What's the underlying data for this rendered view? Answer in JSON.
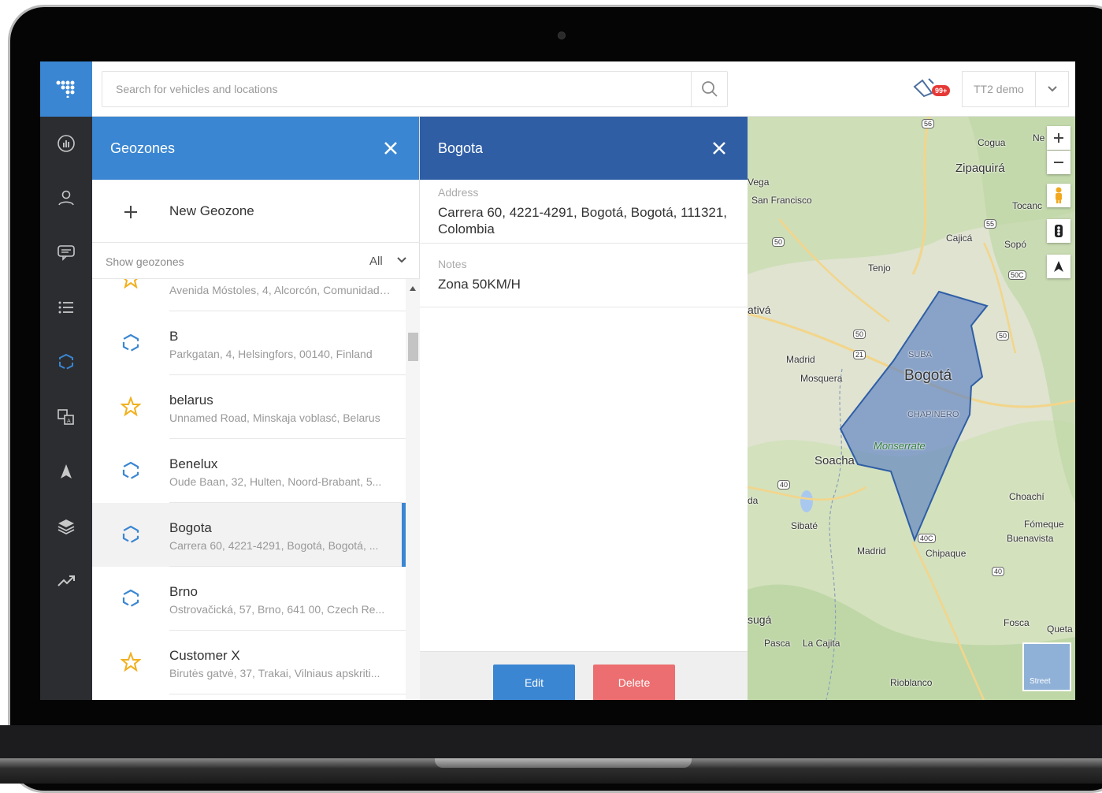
{
  "search": {
    "placeholder": "Search for vehicles and locations"
  },
  "notifications": {
    "badge": "99+"
  },
  "user": {
    "name": "TT2 demo"
  },
  "geozones_panel": {
    "title": "Geozones",
    "new_label": "New Geozone",
    "filter_label": "Show geozones",
    "filter_value": "All",
    "items": [
      {
        "name": "",
        "address": "Avenida Móstoles, 4, Alcorcón, Comunidad de Madrid",
        "icon": "star-icon"
      },
      {
        "name": "B",
        "address": "Parkgatan, 4, Helsingfors, 00140, Finland",
        "icon": "polygon-icon"
      },
      {
        "name": "belarus",
        "address": "Unnamed Road, Minskaja voblasć, Belarus",
        "icon": "star-icon"
      },
      {
        "name": "Benelux",
        "address": "Oude Baan, 32, Hulten, Noord-Brabant, 5...",
        "icon": "polygon-icon"
      },
      {
        "name": "Bogota",
        "address": "Carrera 60, 4221-4291, Bogotá, Bogotá, ...",
        "icon": "polygon-icon",
        "selected": true
      },
      {
        "name": "Brno",
        "address": "Ostrovačická, 57, Brno, 641 00, Czech Re...",
        "icon": "polygon-icon"
      },
      {
        "name": "Customer X",
        "address": "Birutės gatvė, 37, Trakai, Vilniaus apskriti...",
        "icon": "star-icon"
      }
    ]
  },
  "detail_panel": {
    "title": "Bogota",
    "address_label": "Address",
    "address_value": "Carrera 60, 4221-4291, Bogotá, Bogotá, 111321, Colombia",
    "notes_label": "Notes",
    "notes_value": "Zona 50KM/H",
    "edit_label": "Edit",
    "delete_label": "Delete"
  },
  "map": {
    "labels": [
      "Cogua",
      "Zipaquirá",
      "Ne",
      "Vega",
      "San Francisco",
      "Tocanc",
      "Cajicá",
      "Sopó",
      "Tenjo",
      "ativá",
      "Madrid",
      "Mosquera",
      "SUBA",
      "Bogotá",
      "CHAPINERO",
      "Monserrate",
      "Soacha",
      "da",
      "Sibaté",
      "Chipaque",
      "Madrid",
      "Choachí",
      "Fómeque",
      "Buenavista",
      "sugá",
      "Pasca",
      "La Cajita",
      "Fosca",
      "Queta",
      "Rioblanco",
      "Street"
    ],
    "route_shields": [
      "56",
      "55",
      "50",
      "50C",
      "50",
      "21",
      "50",
      "40",
      "40C",
      "40"
    ]
  },
  "colors": {
    "brand_blue": "#3a86d2",
    "header_dark_blue": "#2f5ea5",
    "rail_dark": "#2b2d31",
    "delete_red": "#ec6e70",
    "geozone_fill": "#5b7fc1"
  }
}
